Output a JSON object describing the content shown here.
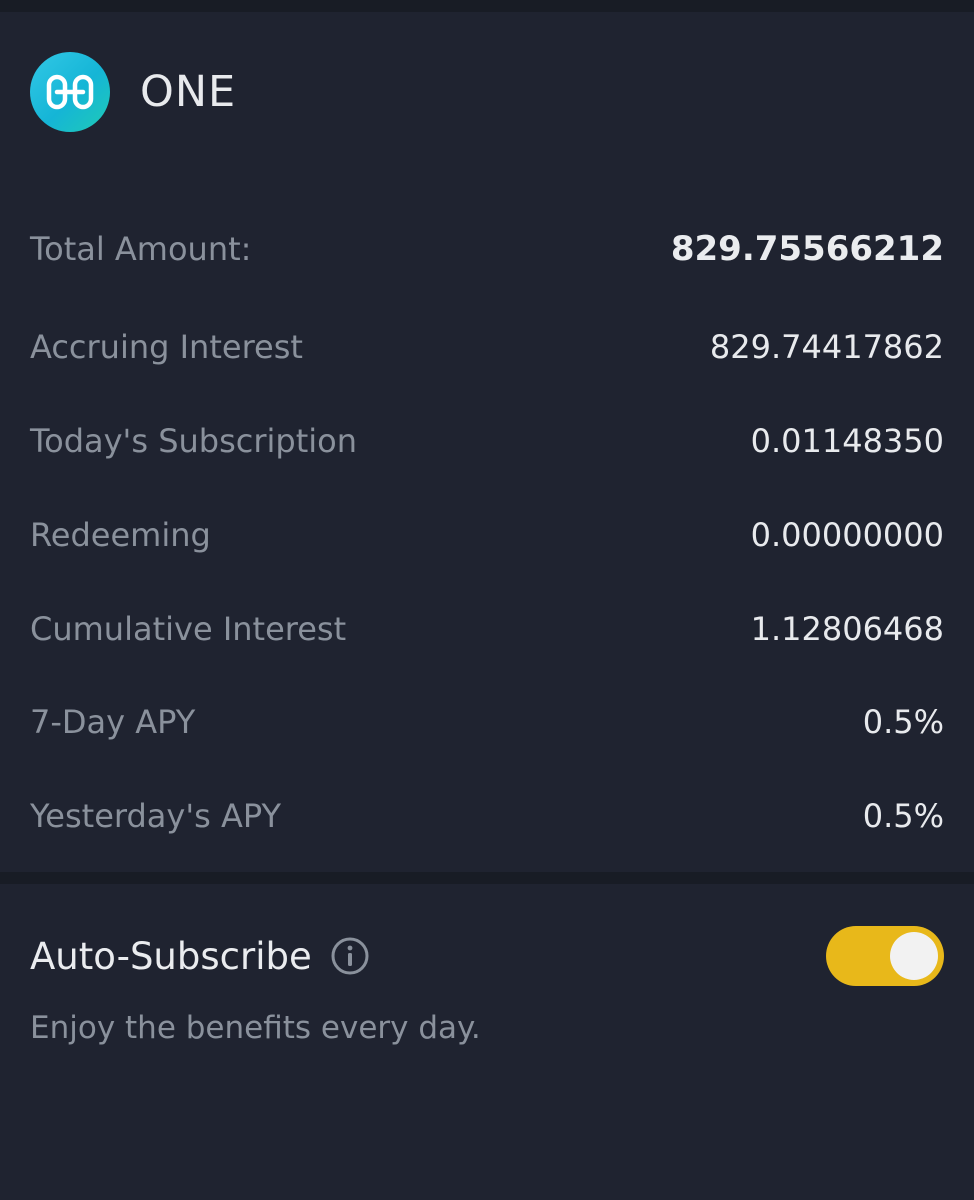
{
  "asset": {
    "name": "ONE",
    "logo_icon": "harmony-one-logo-icon"
  },
  "details": {
    "total_amount": {
      "label": "Total Amount:",
      "value": "829.75566212"
    },
    "accruing_interest": {
      "label": "Accruing Interest",
      "value": "829.74417862"
    },
    "todays_subscription": {
      "label": "Today's Subscription",
      "value": "0.01148350"
    },
    "redeeming": {
      "label": "Redeeming",
      "value": "0.00000000"
    },
    "cumulative_interest": {
      "label": "Cumulative Interest",
      "value": "1.12806468"
    },
    "seven_day_apy": {
      "label": "7-Day APY",
      "value": "0.5%"
    },
    "yesterdays_apy": {
      "label": "Yesterday's APY",
      "value": "0.5%"
    }
  },
  "auto_subscribe": {
    "label": "Auto-Subscribe",
    "description": "Enjoy the benefits every day.",
    "enabled": true,
    "info_icon": "info-icon"
  },
  "colors": {
    "background": "#1f2330",
    "toggle_on": "#e8b81a",
    "label_text": "#8a919c",
    "value_text": "#e8eaed"
  }
}
